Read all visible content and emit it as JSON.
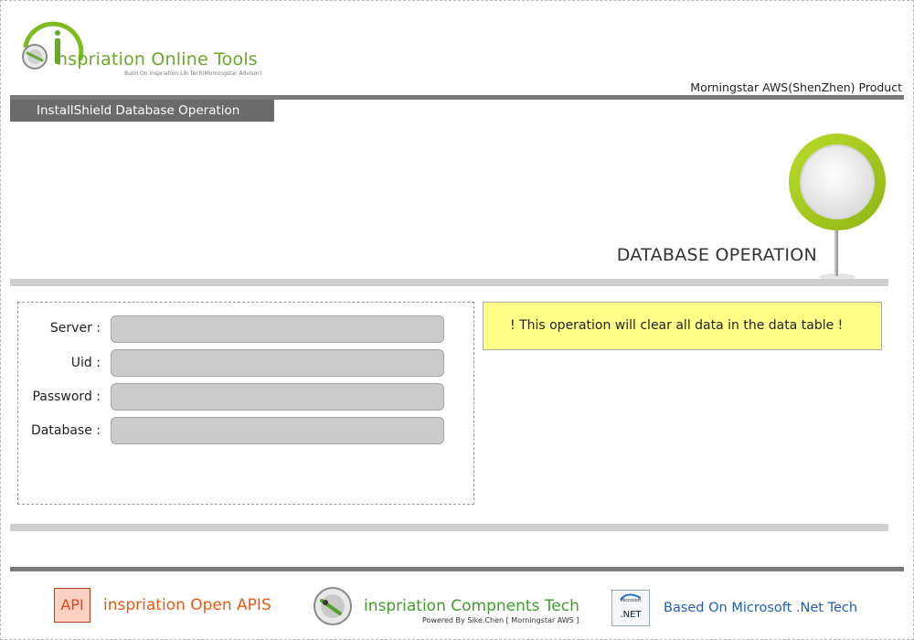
{
  "header": {
    "brand_title": "nspriation Online Tools",
    "brand_subtitle": "Build On Inspriation Lib Tech(Morningstar Advisor)",
    "company": "Morningstar AWS(ShenZhen) Product",
    "tab_label": "InstallShield Database Operation"
  },
  "page": {
    "heading": "DATABASE OPERATION"
  },
  "form": {
    "fields": [
      {
        "label": "Server :",
        "value": ""
      },
      {
        "label": "Uid :",
        "value": ""
      },
      {
        "label": "Password :",
        "value": ""
      },
      {
        "label": "Database :",
        "value": ""
      }
    ]
  },
  "warning": {
    "text": "! This operation will clear all data in the data table !"
  },
  "footer": {
    "api_icon_text": "API",
    "api_label": "inspriation Open APIS",
    "components_label": "inspriation Compnents Tech",
    "powered_by": "Powered By Sike.Chen [ Morningstar AWS ]",
    "net_icon_text": ".NET",
    "net_icon_brand": "Microsoft",
    "net_label": "Based On Microsoft .Net Tech"
  },
  "colors": {
    "brand_green": "#6aa82a",
    "pin_green": "#a8cc1c",
    "warning_bg": "#ffff88",
    "bar_dark": "#7a7a7a",
    "bar_light": "#cfcfcf",
    "api_orange": "#e65a12",
    "net_blue": "#1f5fb5"
  },
  "icons": {
    "logo": "inspiration-logo-icon",
    "pin": "map-pin-icon",
    "api": "api-icon",
    "components": "components-icon",
    "net": "dotnet-icon"
  }
}
